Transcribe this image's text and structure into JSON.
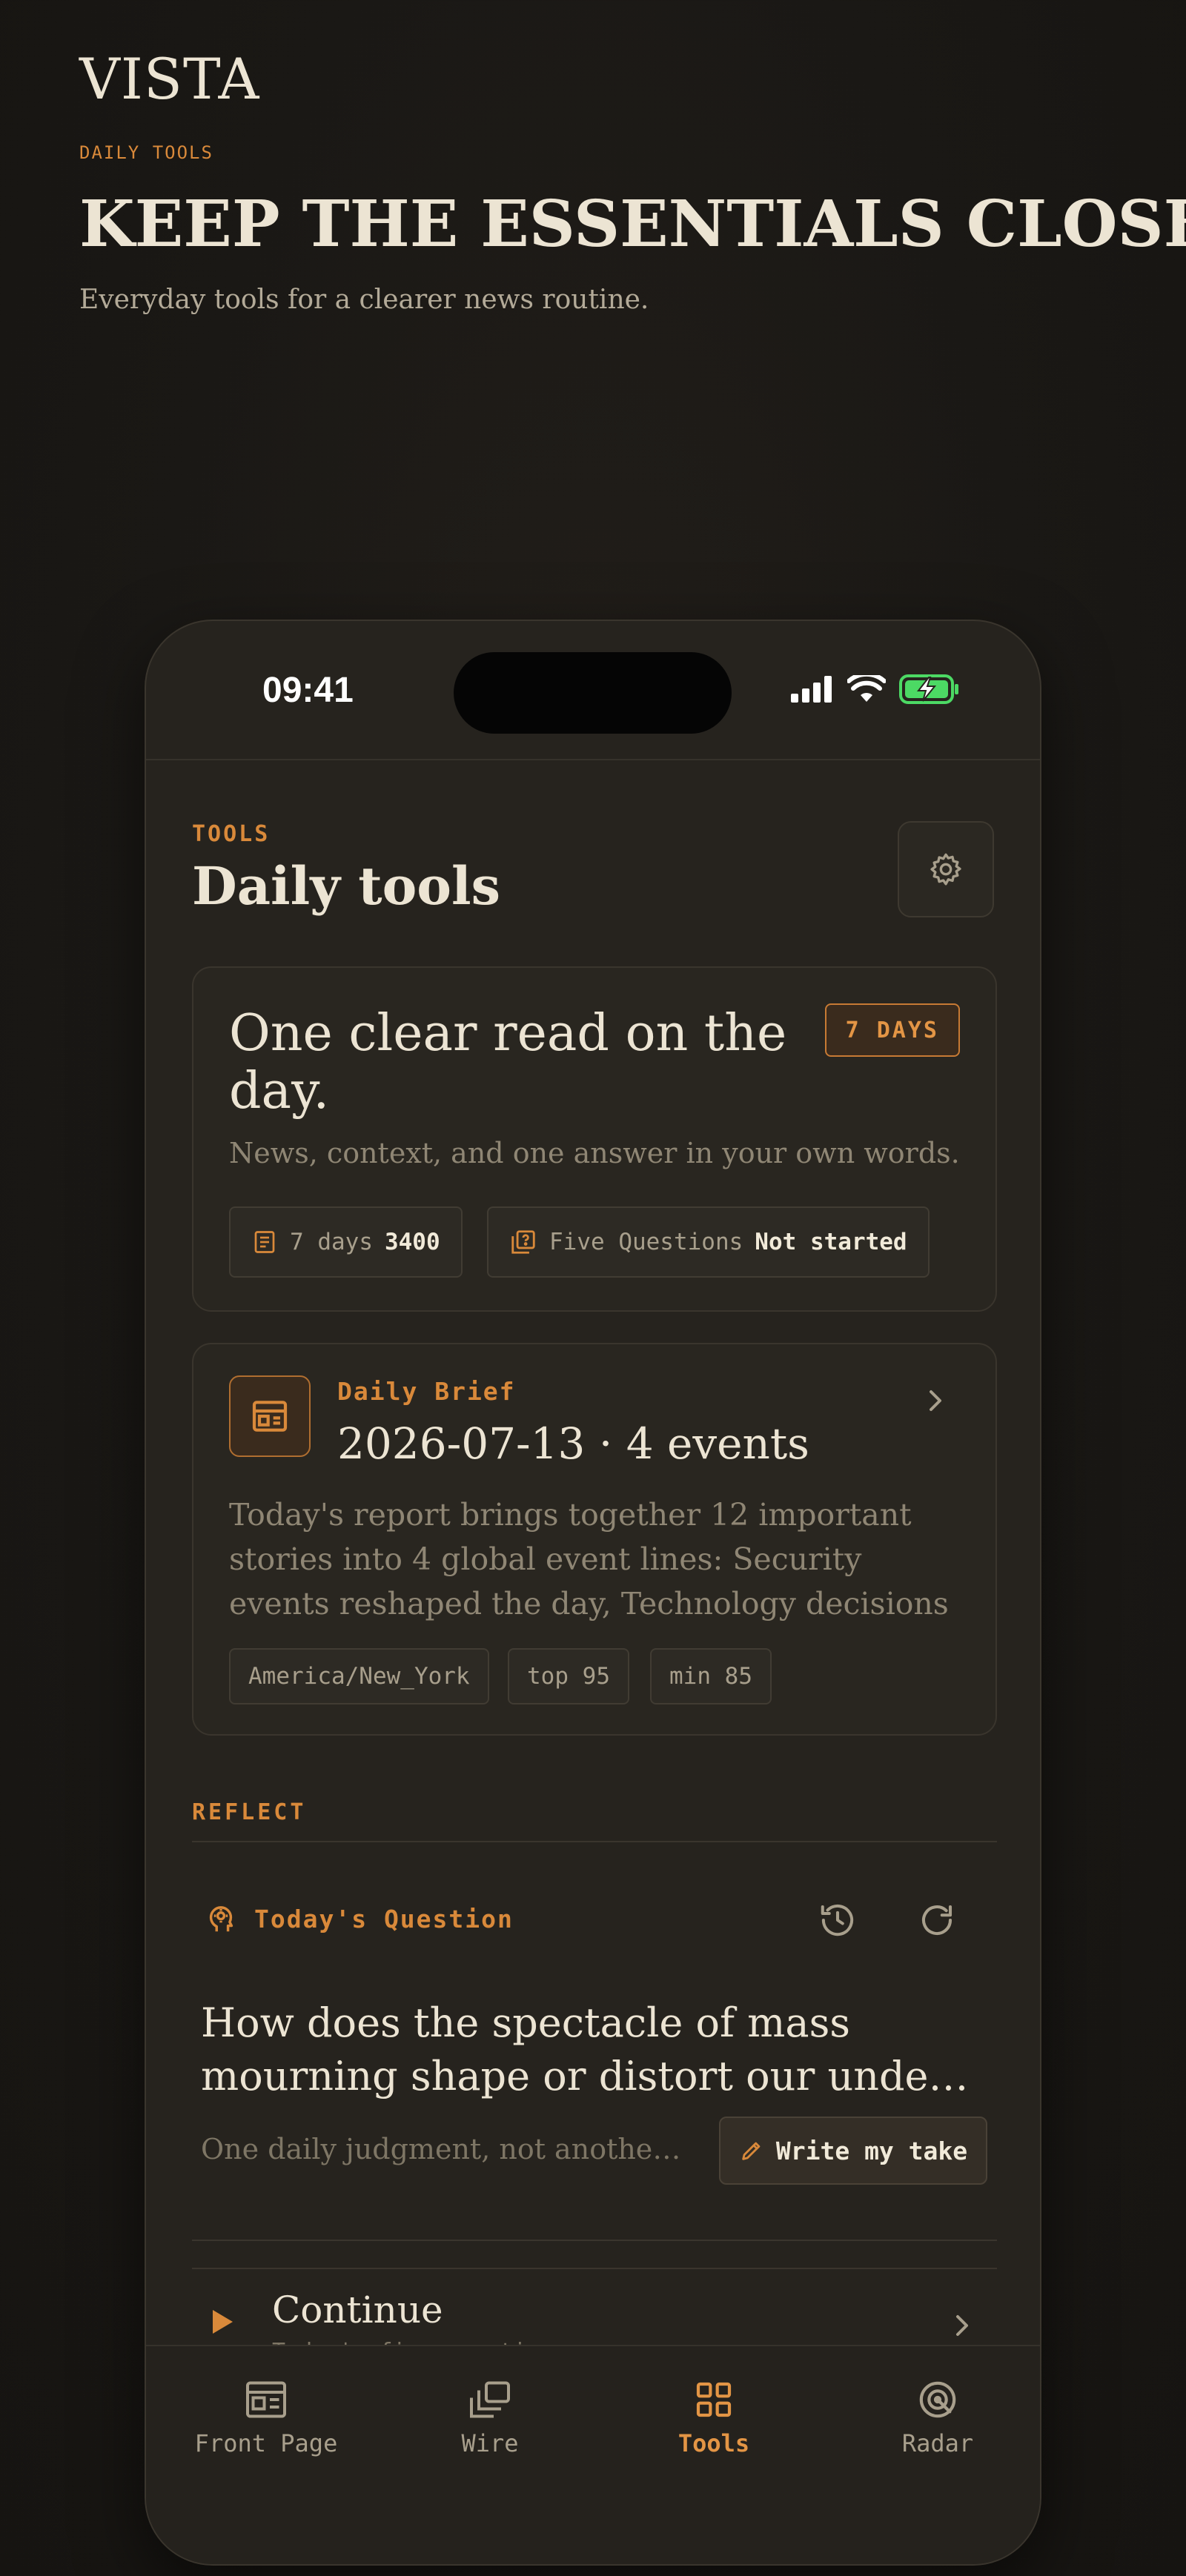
{
  "page": {
    "brand": "VISTA",
    "eyebrow": "DAILY TOOLS",
    "title": "KEEP THE ESSENTIALS CLOSE",
    "subtitle": "Everyday tools for a clearer news routine."
  },
  "status_bar": {
    "time": "09:41",
    "icons": [
      "cellular-signal-icon",
      "wifi-icon",
      "battery-charging-icon"
    ]
  },
  "screen": {
    "eyebrow": "TOOLS",
    "title": "Daily tools",
    "settings_icon": "gear-icon"
  },
  "summary_card": {
    "title": "One clear read on the day.",
    "badge": "7 DAYS",
    "subtitle": "News, context, and one answer in your own words.",
    "stats": [
      {
        "icon": "document-icon",
        "label": "7 days",
        "value": "3400"
      },
      {
        "icon": "question-cards-icon",
        "label": "Five Questions",
        "value": "Not started"
      }
    ]
  },
  "brief_card": {
    "icon": "newspaper-icon",
    "label": "Daily Brief",
    "title": "2026-07-13 · 4 events",
    "body": "Today's report brings together 12 important stories into 4 global event lines: Security events reshaped the day, Technology decisions moved …",
    "tags": [
      "America/New_York",
      "top 95",
      "min 85"
    ]
  },
  "reflect": {
    "section_label": "REFLECT",
    "question_label": "Today's Question",
    "question_line1": "How does the spectacle of mass",
    "question_line2": "mourning shape or distort our underst…",
    "hint": "One daily judgment, not another s…",
    "write_button": "Write my take",
    "continue_title": "Continue",
    "continue_sub": "Today's five questions"
  },
  "tab_bar": {
    "tabs": [
      {
        "label": "Front Page",
        "icon": "front-page-icon",
        "active": false
      },
      {
        "label": "Wire",
        "icon": "wire-stack-icon",
        "active": false
      },
      {
        "label": "Tools",
        "icon": "grid-icon",
        "active": true
      },
      {
        "label": "Radar",
        "icon": "radar-icon",
        "active": false
      }
    ]
  },
  "colors": {
    "accent": "#d9893a",
    "background": "#1a1815",
    "phone_surface": "#26231e",
    "text": "#ece4d3",
    "muted": "#8f8674",
    "battery": "#4cd964"
  }
}
